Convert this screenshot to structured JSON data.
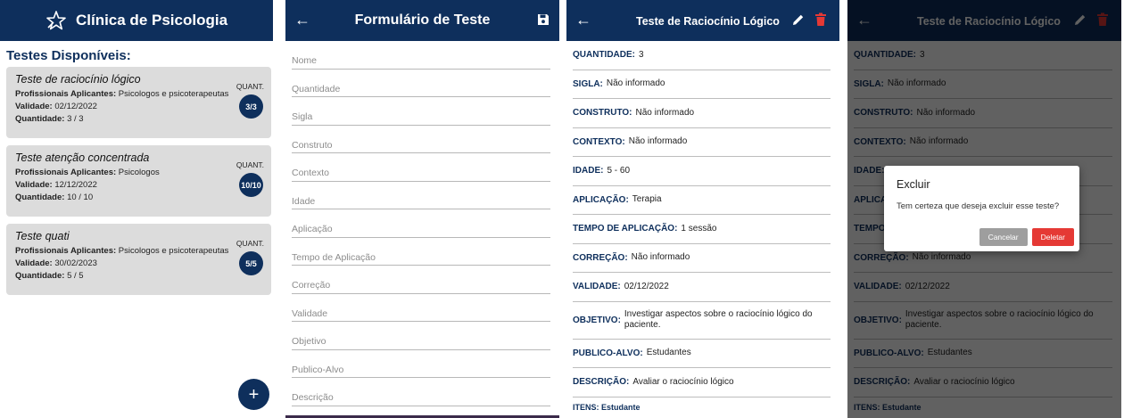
{
  "colors": {
    "primary": "#0e2f5c",
    "card_bg": "#dcdcdc",
    "danger": "#e53935",
    "muted_button": "#9e9e9e"
  },
  "home": {
    "app_title": "Clínica de Psicologia",
    "logo_icon": "star-logo-icon",
    "section_title": "Testes Disponíveis:",
    "tests": [
      {
        "title": "Teste de raciocínio lógico",
        "prof_label": "Profissionais Aplicantes:",
        "prof_value": "Psicologos e psicoterapeutas",
        "valid_label": "Validade:",
        "valid_value": "02/12/2022",
        "qty_label": "Quantidade:",
        "qty_value": "3 / 3",
        "quant_label": "QUANT.",
        "badge": "3/3"
      },
      {
        "title": "Teste atenção concentrada",
        "prof_label": "Profissionais Aplicantes:",
        "prof_value": "Psicologos",
        "valid_label": "Validade:",
        "valid_value": "12/12/2022",
        "qty_label": "Quantidade:",
        "qty_value": "10 / 10",
        "quant_label": "QUANT.",
        "badge": "10/10"
      },
      {
        "title": "Teste quati",
        "prof_label": "Profissionais Aplicantes:",
        "prof_value": "Psicologos e psicoterapeutas",
        "valid_label": "Validade:",
        "valid_value": "30/02/2023",
        "qty_label": "Quantidade:",
        "qty_value": "5 / 5",
        "quant_label": "QUANT.",
        "badge": "5/5"
      }
    ],
    "fab_label": "+"
  },
  "form": {
    "back_icon": "arrow-left-icon",
    "title": "Formulário de Teste",
    "save_icon": "save-icon",
    "fields": [
      "Nome",
      "Quantidade",
      "Sigla",
      "Construto",
      "Contexto",
      "Idade",
      "Aplicação",
      "Tempo de Aplicação",
      "Correção",
      "Validade",
      "Objetivo",
      "Publico-Alvo",
      "Descrição"
    ]
  },
  "detail": {
    "back_icon": "arrow-left-icon",
    "title": "Teste de Raciocínio Lógico",
    "edit_icon": "pencil-icon",
    "delete_icon": "trash-icon",
    "rows": [
      {
        "label": "QUANTIDADE:",
        "value": "3"
      },
      {
        "label": "SIGLA:",
        "value": "Não informado"
      },
      {
        "label": "CONSTRUTO:",
        "value": "Não informado"
      },
      {
        "label": "CONTEXTO:",
        "value": "Não informado"
      },
      {
        "label": "IDADE:",
        "value": "5 - 60"
      },
      {
        "label": "APLICAÇÃO:",
        "value": "Terapia"
      },
      {
        "label": "TEMPO DE APLICAÇÃO:",
        "value": "1 sessão"
      },
      {
        "label": "CORREÇÃO:",
        "value": "Não informado"
      },
      {
        "label": "VALIDADE:",
        "value": "02/12/2022"
      },
      {
        "label": "OBJETIVO:",
        "value": "Investigar aspectos sobre o raciocínio lógico do paciente."
      },
      {
        "label": "PUBLICO-ALVO:",
        "value": "Estudantes"
      },
      {
        "label": "DESCRIÇÃO:",
        "value": "Avaliar o raciocínio lógico"
      }
    ],
    "partial_row": "ITENS: Estudante"
  },
  "dialog": {
    "title": "Excluir",
    "message": "Tem certeza que deseja excluir esse teste?",
    "cancel_label": "Cancelar",
    "delete_label": "Deletar"
  }
}
